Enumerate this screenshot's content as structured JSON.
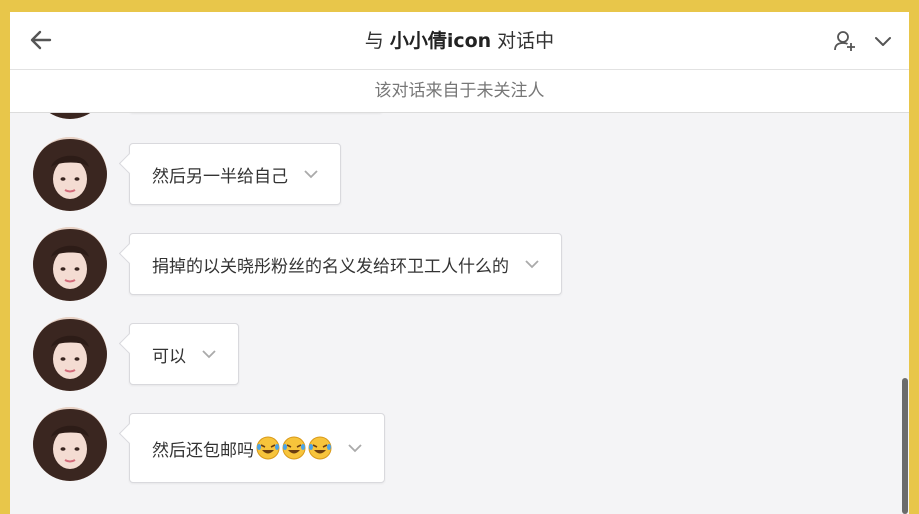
{
  "header": {
    "title_prefix": "与",
    "contact_name": "小小倩icon",
    "title_suffix": "对话中"
  },
  "notice": "该对话来自于未关注人",
  "messages": [
    {
      "text": "然后另一半给自己"
    },
    {
      "text": "捐掉的以关晓彤粉丝的名义发给环卫工人什么的"
    },
    {
      "text": "可以"
    },
    {
      "text": "然后还包邮吗",
      "emoji": [
        "laughing-crying-emoji",
        "laughing-crying-emoji",
        "laughing-crying-emoji"
      ]
    }
  ],
  "colors": {
    "frame": "#e8c64a",
    "chat_bg": "#f4f4f6",
    "bubble": "#ffffff"
  }
}
